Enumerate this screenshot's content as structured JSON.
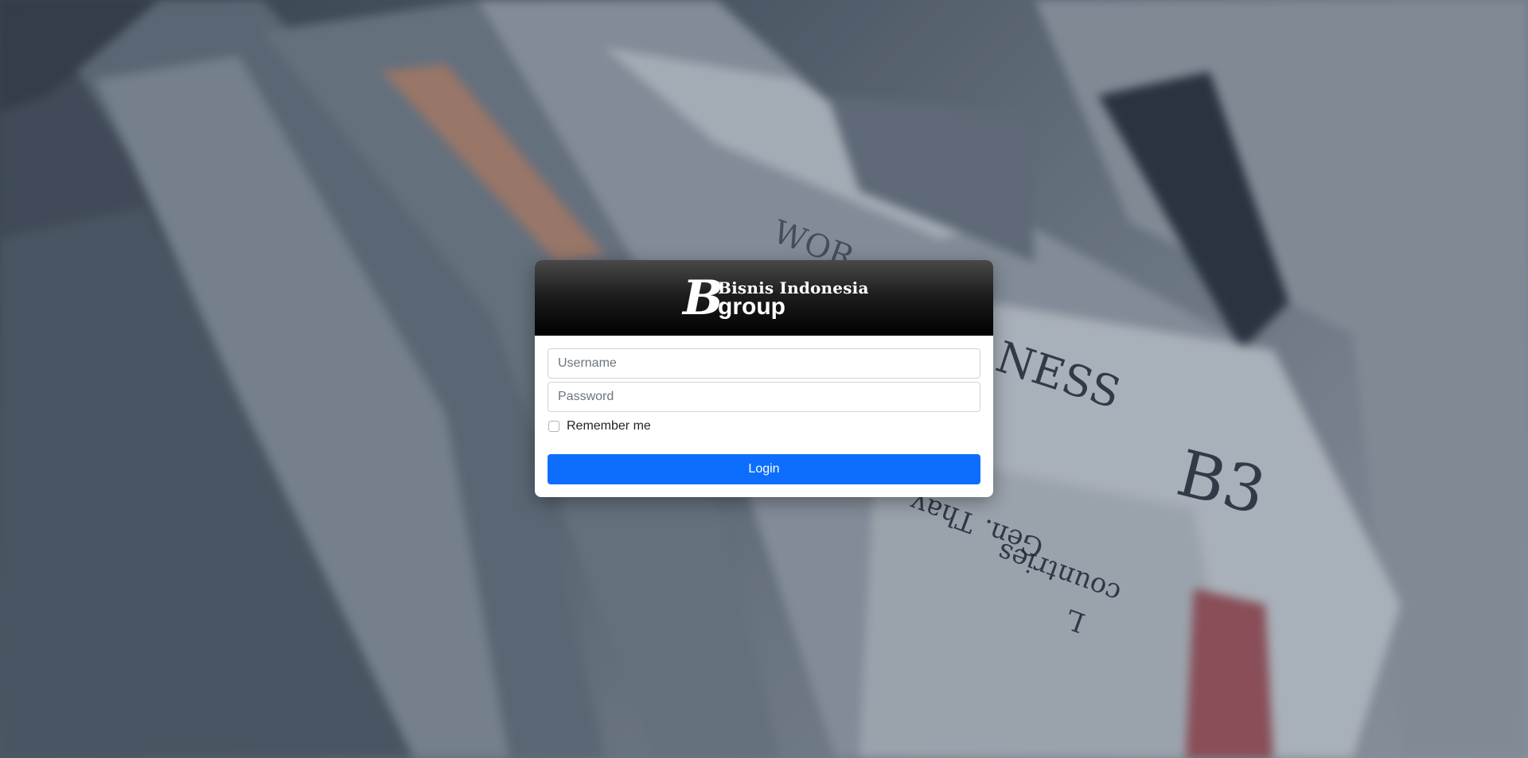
{
  "header": {
    "logo_b": "B",
    "logo_top": "Bisnis Indonesia",
    "logo_bottom": "group"
  },
  "form": {
    "username_placeholder": "Username",
    "username_value": "",
    "password_placeholder": "Password",
    "password_value": "",
    "remember_label": "Remember me",
    "remember_checked": false,
    "login_label": "Login"
  },
  "background": {
    "newspaper_texts": [
      "NESS",
      "B3",
      "countries",
      "Gen. Thay",
      "L",
      "WOR"
    ]
  },
  "colors": {
    "accent": "#0d6efd",
    "header_dark": "#000000",
    "card_bg": "#ffffff"
  }
}
